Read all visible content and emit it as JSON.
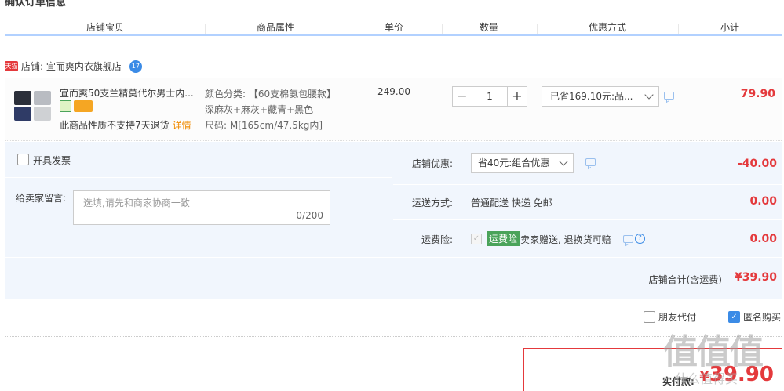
{
  "section_title": "确认订单信息",
  "columns": [
    "店铺宝贝",
    "商品属性",
    "单价",
    "数量",
    "优惠方式",
    "小计"
  ],
  "shop": {
    "badge": "天猫",
    "label": "店铺: 宜而爽内衣旗舰店",
    "wangwang_count": "17"
  },
  "item": {
    "title": "宜而爽50支兰精莫代尔男士内...",
    "no_return_text": "此商品性质不支持7天退货",
    "detail_link": "详情",
    "props": {
      "color": "颜色分类: 【60支棉氨包腰款】",
      "color_detail": "深麻灰+麻灰+藏青+黑色",
      "size": "尺码: M[165cm/47.5kg内]"
    },
    "unit_price": "249.00",
    "qty_minus": "−",
    "quantity": "1",
    "qty_plus": "+",
    "promo": "已省169.10元:品...",
    "subtotal": "79.90"
  },
  "order": {
    "invoice_label": "开具发票",
    "remark_label": "给卖家留言:",
    "remark_placeholder": "选填,请先和商家协商一致",
    "remark_count": "0/200",
    "shop_discount_label": "店铺优惠:",
    "shop_discount_select": "省40元:组合优惠",
    "shop_discount_amount": "-40.00",
    "shipping_label": "运送方式:",
    "shipping_value": "普通配送 快递 免邮",
    "shipping_amount": "0.00",
    "insurance_label": "运费险:",
    "insurance_tag": "运费险",
    "insurance_text": "卖家赠送, 退换货可赔",
    "insurance_amount": "0.00",
    "total_label": "店铺合计(含运费)",
    "total_amount": "¥39.90"
  },
  "options": {
    "friend_pay": "朋友代付",
    "anonymous": "匿名购买"
  },
  "payment": {
    "label": "实付款:",
    "currency": "¥",
    "amount": "39.90"
  },
  "watermark": {
    "text": "值值值",
    "url": "什么值得买"
  }
}
